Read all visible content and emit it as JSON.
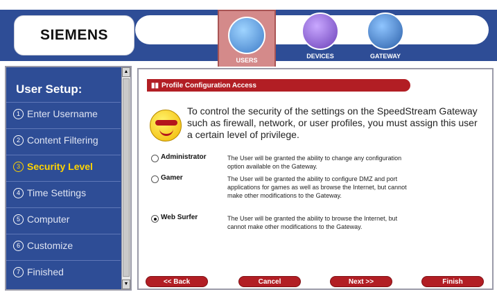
{
  "brand": {
    "logo_text": "SIEMENS"
  },
  "nav_tabs": [
    {
      "label": "USERS",
      "icon": "users-icon",
      "active": true
    },
    {
      "label": "DEVICES",
      "icon": "devices-gear-icon",
      "active": false
    },
    {
      "label": "GATEWAY",
      "icon": "gateway-icon",
      "active": false
    }
  ],
  "sidebar": {
    "title": "User Setup:",
    "steps": [
      {
        "num": "1",
        "label": "Enter Username"
      },
      {
        "num": "2",
        "label": "Content Filtering"
      },
      {
        "num": "3",
        "label": "Security Level",
        "active": true
      },
      {
        "num": "4",
        "label": "Time Settings"
      },
      {
        "num": "5",
        "label": "Computer"
      },
      {
        "num": "6",
        "label": "Customize"
      },
      {
        "num": "7",
        "label": "Finished"
      }
    ]
  },
  "main": {
    "section_title": "Profile Configuration Access",
    "intro": "To control the security of the settings on the SpeedStream Gateway such as firewall, network, or user profiles, you must assign this user a certain level of privilege.",
    "options": [
      {
        "label": "Administrator",
        "description": "The User will be granted the ability to change any configuration option available on the Gateway.",
        "checked": false
      },
      {
        "label": "Gamer",
        "description": "The User will be granted the ability to configure DMZ and port applications for games as well as browse the Internet, but cannot make other modifications to the Gateway.",
        "checked": false
      },
      {
        "label": "Web Surfer",
        "description": "The User will be granted the ability to browse the Internet, but cannot make other modifications to the Gateway.",
        "checked": true
      }
    ],
    "buttons": {
      "back": "<< Back",
      "cancel": "Cancel",
      "next": "Next >>",
      "finish": "Finish"
    }
  },
  "colors": {
    "header_blue": "#2e4d96",
    "accent_red": "#b21e24",
    "active_step": "#ffd400",
    "active_tab": "#d48a8a"
  }
}
